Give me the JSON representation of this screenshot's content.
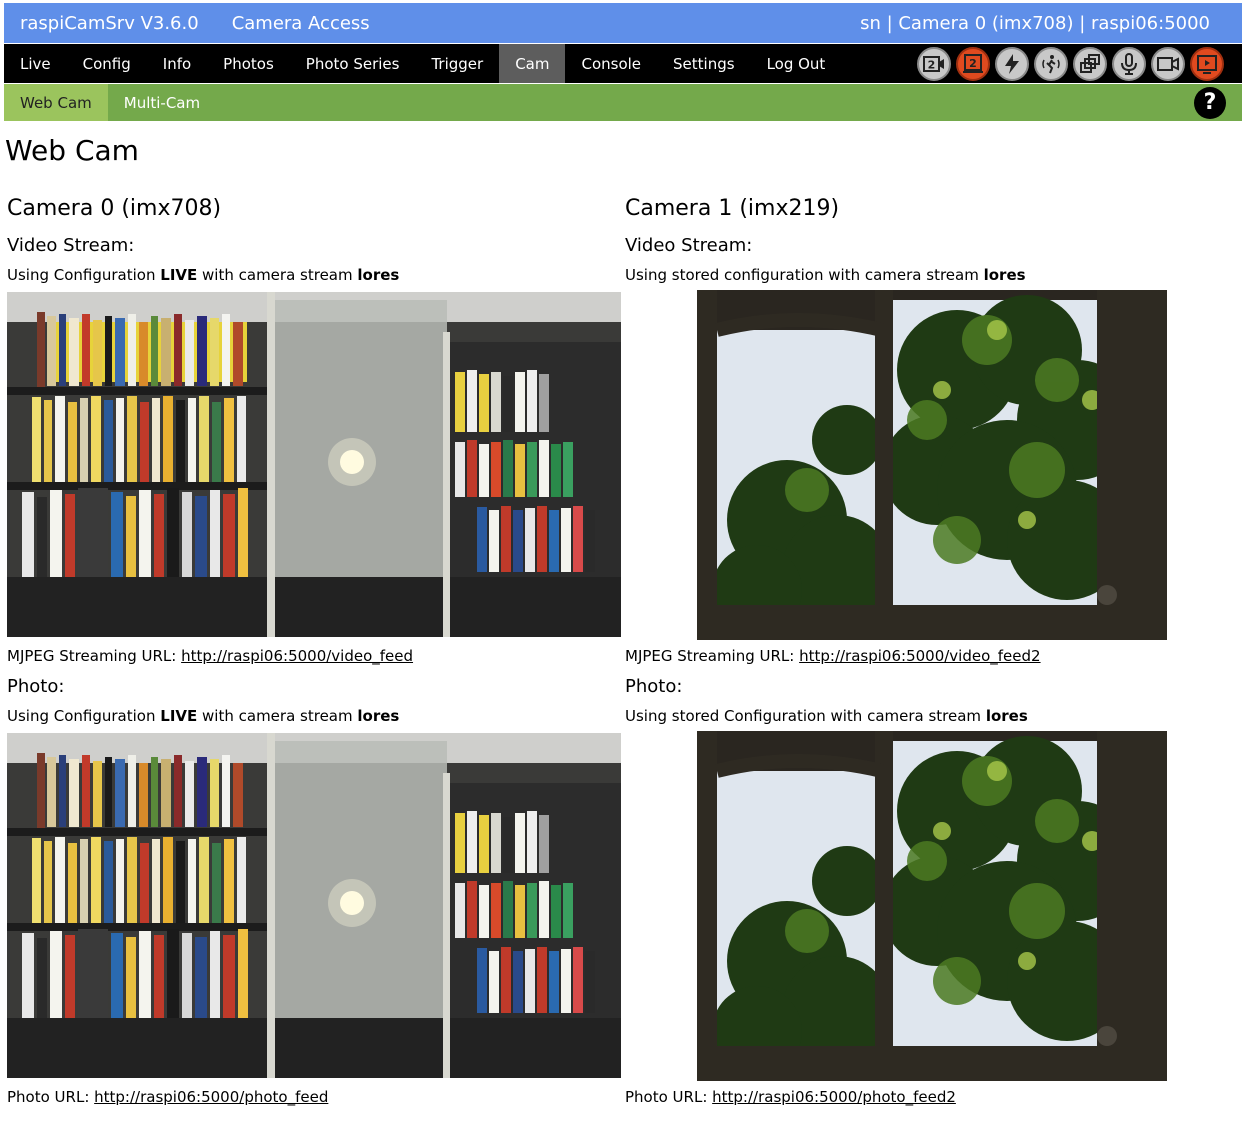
{
  "header": {
    "app_title": "raspiCamSrv V3.6.0",
    "section": "Camera Access",
    "status": "sn | Camera 0 (imx708) | raspi06:5000"
  },
  "nav": {
    "items": [
      "Live",
      "Config",
      "Info",
      "Photos",
      "Photo Series",
      "Trigger",
      "Cam",
      "Console",
      "Settings",
      "Log Out"
    ],
    "active": "Cam",
    "icons": [
      {
        "name": "camera-2-icon",
        "text": "2"
      },
      {
        "name": "camera-swap-2-icon",
        "text": "2"
      },
      {
        "name": "lightning-icon"
      },
      {
        "name": "motion-icon"
      },
      {
        "name": "multi-window-icon"
      },
      {
        "name": "microphone-icon"
      },
      {
        "name": "video-camera-icon"
      },
      {
        "name": "stream-icon"
      }
    ]
  },
  "subnav": {
    "items": [
      "Web Cam",
      "Multi-Cam"
    ],
    "active": "Web Cam",
    "help": "?"
  },
  "page": {
    "title": "Web Cam"
  },
  "cameras": [
    {
      "title": "Camera 0 (imx708)",
      "video_label": "Video Stream:",
      "video_config_prefix": "Using Configuration ",
      "video_config_name": "LIVE",
      "video_config_mid": " with camera stream ",
      "video_stream": "lores",
      "stream_url_label": "MJPEG Streaming URL: ",
      "stream_url": "http://raspi06:5000/video_feed",
      "photo_label": "Photo:",
      "photo_config_prefix": "Using Configuration ",
      "photo_config_name": "LIVE",
      "photo_config_mid": " with camera stream ",
      "photo_stream": "lores",
      "photo_url_label": "Photo URL: ",
      "photo_url": "http://raspi06:5000/photo_feed"
    },
    {
      "title": "Camera 1 (imx219)",
      "video_label": "Video Stream:",
      "video_config_prefix": "Using stored configuration with camera stream ",
      "video_stream": "lores",
      "stream_url_label": "MJPEG Streaming URL: ",
      "stream_url": "http://raspi06:5000/video_feed2",
      "photo_label": "Photo:",
      "photo_config_prefix": "Using stored Configuration with camera stream ",
      "photo_stream": "lores",
      "photo_url_label": "Photo URL: ",
      "photo_url": "http://raspi06:5000/photo_feed2"
    }
  ],
  "colors": {
    "title_bar": "#5f8fe9",
    "nav_bar": "#000000",
    "nav_active": "#5d5d5d",
    "sub_bar": "#74a94b",
    "sub_active": "#9bc45d"
  }
}
